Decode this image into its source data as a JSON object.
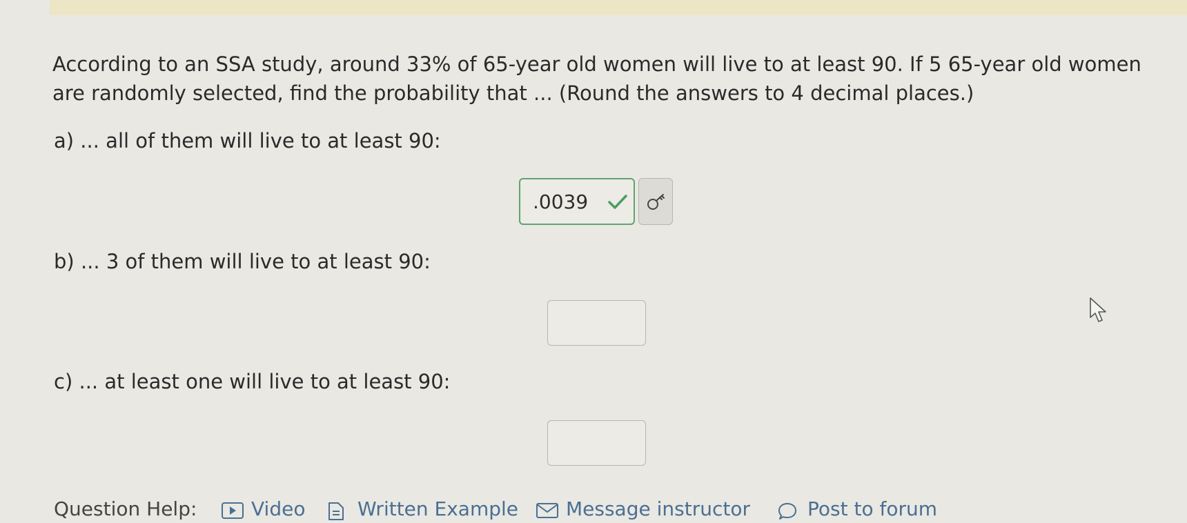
{
  "question": {
    "text": "According to an SSA study, around 33% of 65-year old women will live to at least 90. If 5 65-year old women are randomly selected, find the probability that ... (Round the answers to 4 decimal places.)"
  },
  "parts": [
    {
      "label": "a) ... all of them will live to at least 90:",
      "answer": ".0039",
      "status": "correct"
    },
    {
      "label": "b) ... 3 of them will live to at least 90:",
      "answer": ""
    },
    {
      "label": "c) ... at least one will live to at least 90:",
      "answer": ""
    }
  ],
  "icons": {
    "check": "check-icon",
    "key": "key-icon",
    "cursor": "mouse-cursor-icon",
    "video": "video-icon",
    "document": "document-icon",
    "envelope": "envelope-icon",
    "forum": "speech-bubble-icon"
  },
  "colors": {
    "correct": "#5ea36f",
    "link": "#4a6f91"
  },
  "help": {
    "label": "Question Help:",
    "video": "Video",
    "written_example": "Written Example",
    "message_instructor": "Message instructor",
    "post_to_forum": "Post to forum"
  }
}
